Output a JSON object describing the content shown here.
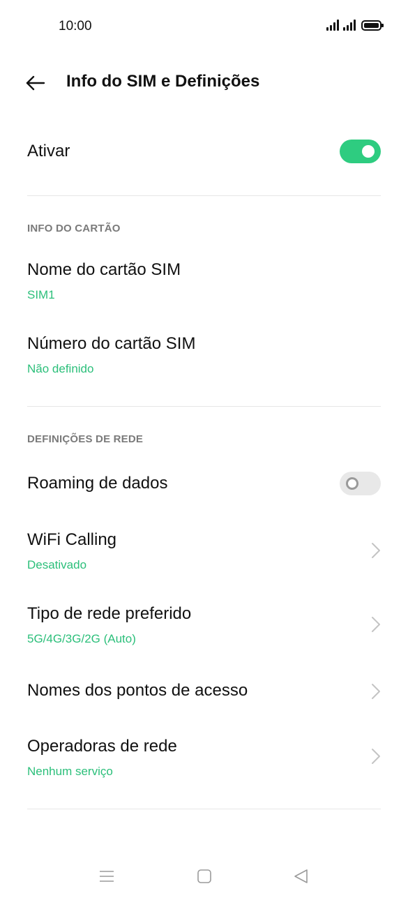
{
  "status_bar": {
    "time": "10:00"
  },
  "header": {
    "title": "Info do SIM e Definições",
    "back_icon": "arrow-left-icon"
  },
  "activate": {
    "label": "Ativar",
    "enabled": true
  },
  "card_info": {
    "section_label": "INFO DO CARTÃO",
    "sim_name": {
      "label": "Nome do cartão SIM",
      "value": "SIM1"
    },
    "sim_number": {
      "label": "Número do cartão SIM",
      "value": "Não definido"
    }
  },
  "network_settings": {
    "section_label": "DEFINIÇÕES DE REDE",
    "data_roaming": {
      "label": "Roaming de dados",
      "enabled": false
    },
    "wifi_calling": {
      "label": "WiFi Calling",
      "value": "Desativado"
    },
    "preferred_network": {
      "label": "Tipo de rede preferido",
      "value": "5G/4G/3G/2G (Auto)"
    },
    "access_points": {
      "label": "Nomes dos pontos de acesso"
    },
    "network_operators": {
      "label": "Operadoras de rede",
      "value": "Nenhum serviço"
    }
  },
  "nav_bar": {
    "menu_icon": "menu-icon",
    "home_icon": "home-square-icon",
    "back_icon": "back-triangle-icon"
  },
  "colors": {
    "accent": "#2bbf7a",
    "toggle_on": "#2ecc80",
    "toggle_off": "#e8e8e8",
    "section_header": "#7a7a7a",
    "divider": "#e6e6e6"
  }
}
